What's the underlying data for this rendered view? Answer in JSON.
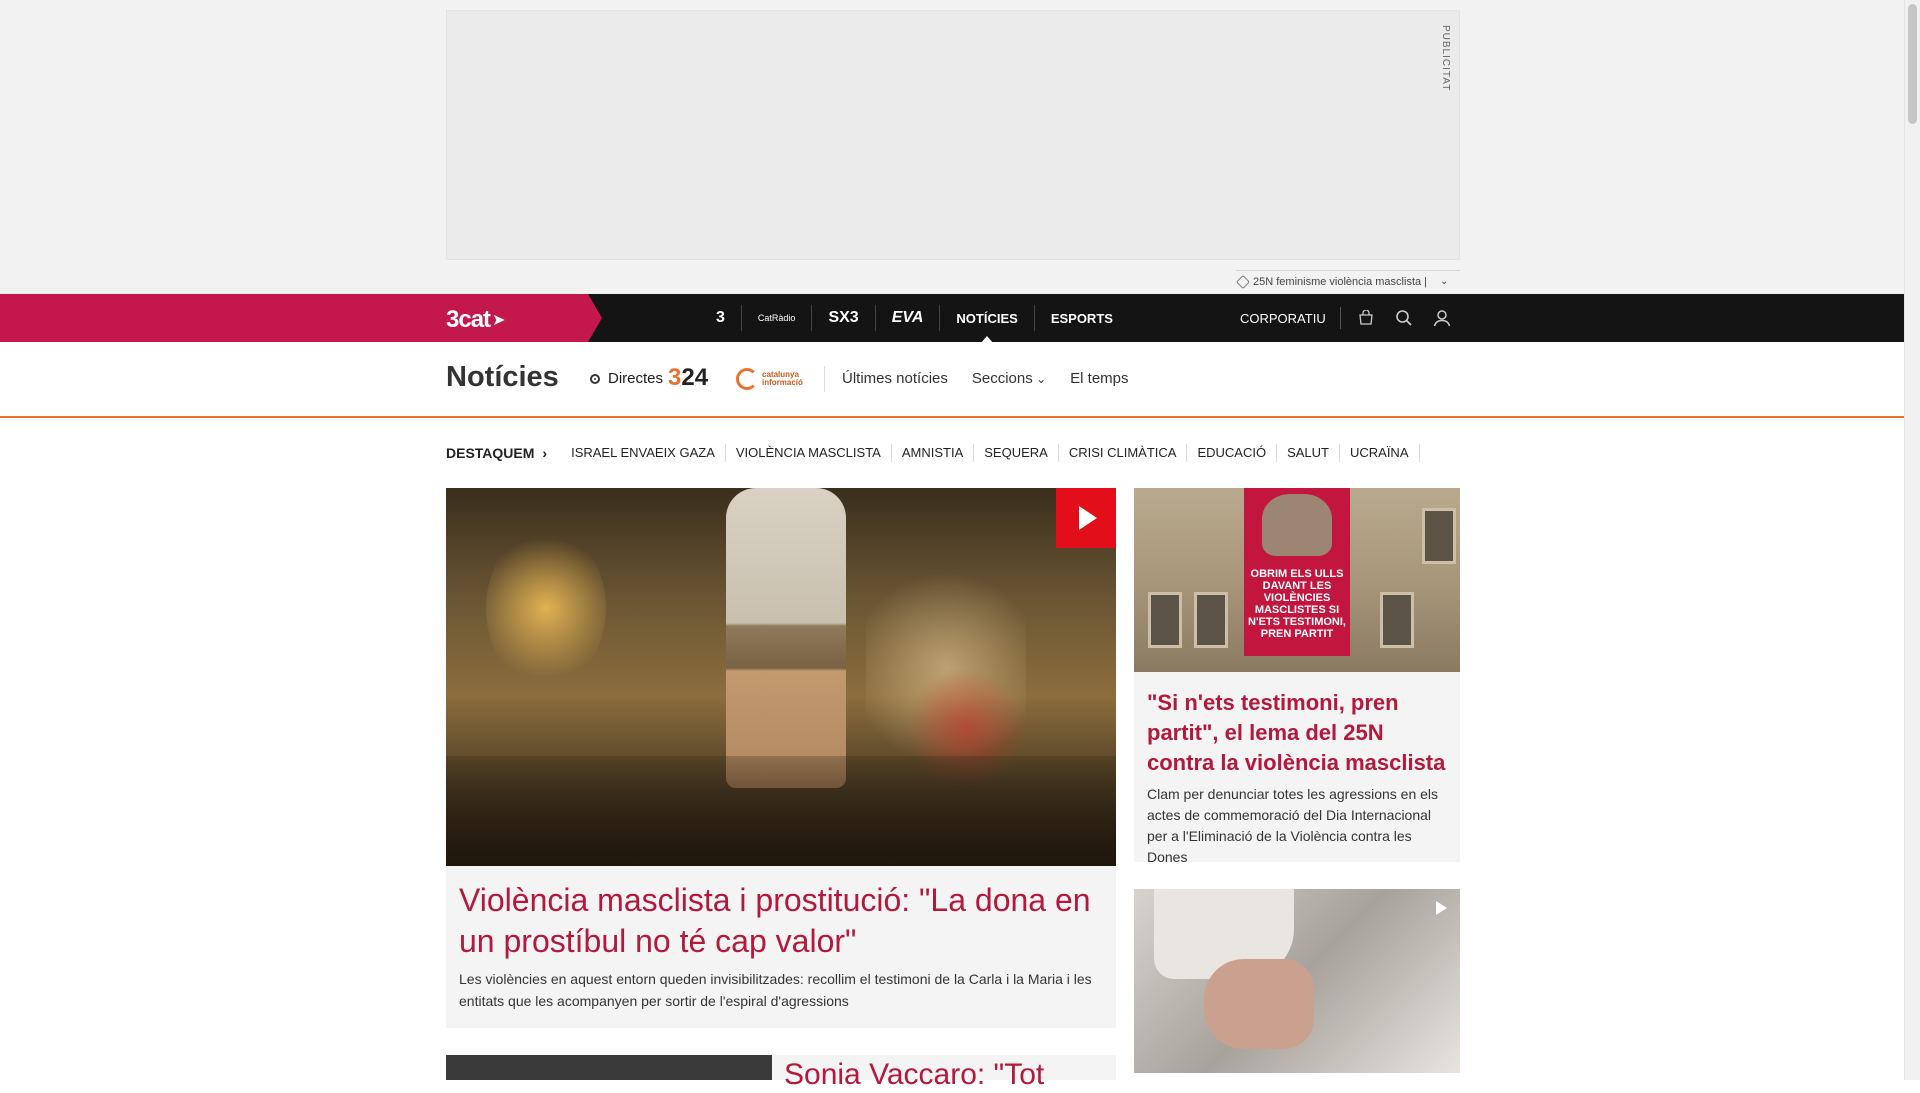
{
  "ad": {
    "label": "PUBLICITAT",
    "tag_text": "25N feminisme violència masclista |"
  },
  "topnav": {
    "brand": "3cat",
    "channels": [
      {
        "label": "3",
        "icon": "tv3-logo"
      },
      {
        "label": "CatRàdio",
        "icon": "catradio-logo"
      },
      {
        "label": "SX3",
        "icon": "sx3-logo"
      },
      {
        "label": "EVA",
        "icon": "eva-logo"
      },
      {
        "label": "NOTÍCIES"
      },
      {
        "label": "ESPORTS"
      }
    ],
    "corporate": "CORPORATIU"
  },
  "section": {
    "title": "Notícies",
    "directes": "Directes",
    "logo_324": {
      "prefix": "3",
      "suffix": "24"
    },
    "logo_cat": "catalunya informació",
    "links": [
      "Últimes notícies",
      "Seccions",
      "El temps"
    ]
  },
  "topics": {
    "lead": "DESTAQUEM",
    "items": [
      "ISRAEL ENVAEIX GAZA",
      "VIOLÈNCIA MASCLISTA",
      "AMNISTIA",
      "SEQUERA",
      "CRISI CLIMÀTICA",
      "EDUCACIÓ",
      "SALUT",
      "UCRAÏNA"
    ]
  },
  "main_article": {
    "title": "Violència masclista i prostitució: \"La dona en un prostíbul no té cap valor\"",
    "summary": "Les violències en aquest entorn queden invisibilitzades: recollim el testimoni de la Carla i la Maria i les entitats que les acompanyen per sortir de l'espiral d'agressions"
  },
  "side_article_1": {
    "title": "\"Si n'ets testimoni, pren partit\", el lema del 25N contra la violència masclista",
    "summary": "Clam per denunciar totes les agressions en els actes de commemoració del Dia Internacional per a l'Eliminació de la Violència contra les Dones",
    "banner_text": "OBRIM ELS ULLS DAVANT LES VIOLÈNCIES MASCLISTES SI N'ETS TESTIMONI, PREN PARTIT"
  },
  "bottom_article": {
    "title_partial": "Sonia Vaccaro: \"Tot"
  },
  "colors": {
    "brand_red": "#c4184d",
    "headline": "#b4183c",
    "accent_orange": "#e9732b",
    "play_red": "#e20f1a"
  }
}
